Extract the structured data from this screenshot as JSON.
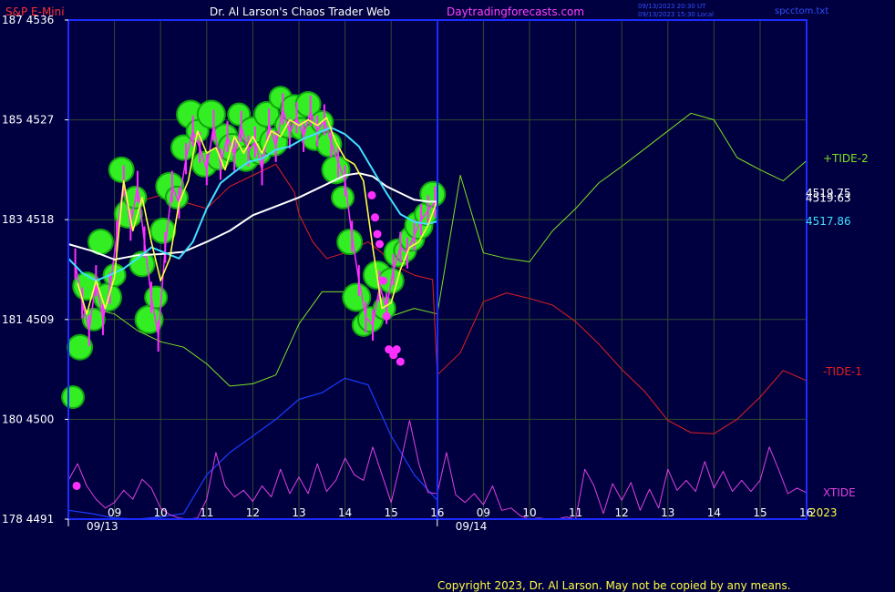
{
  "header": {
    "instrument": "S&P E-Mini",
    "site_title": "Dr. Al Larson's Chaos Trader Web",
    "site_url": "Daytradingforecasts.com",
    "timestamp_1": "09/13/2023 20:30 UT",
    "timestamp_2": "09/13/2023 15:30 Local",
    "file_name": "spcctom.txt"
  },
  "footer": {
    "copyright": "Copyright 2023, Dr. Al Larson. May not be copied by any means.",
    "year": "2023"
  },
  "colors": {
    "background": "#000040",
    "plot_border": "#1c2cff",
    "grid": "#2f4a2f",
    "axis_text": "#ffffff",
    "header_red": "#ff3030",
    "header_white": "#ffffff",
    "header_magenta": "#ff40ff",
    "header_blue": "#3050ff",
    "tide2": "#7ee020",
    "tide1": "#e02020",
    "xtide": "#e040e0",
    "blue_line": "#1a3cff",
    "white_ma": "#ffffff",
    "cyan_ma": "#40e0ff",
    "yellow_ma": "#ffff40",
    "price_bar": "#ff30ff",
    "bubble": "#33ee22",
    "bubble_dark": "#11a511",
    "marker": "#ff30ff"
  },
  "chart_data": {
    "type": "line",
    "y_ticks": [
      {
        "label": "187  4536",
        "value": 4536
      },
      {
        "label": "185  4527",
        "value": 4527
      },
      {
        "label": "183  4518",
        "value": 4518
      },
      {
        "label": "181  4509",
        "value": 4509
      },
      {
        "label": "180  4500",
        "value": 4500
      },
      {
        "label": "178  4491",
        "value": 4491
      }
    ],
    "ylim": [
      4491,
      4536
    ],
    "xlim": [
      0,
      16
    ],
    "x_ticks": [
      {
        "label": "09",
        "x": 1
      },
      {
        "label": "10",
        "x": 2
      },
      {
        "label": "11",
        "x": 3
      },
      {
        "label": "12",
        "x": 4
      },
      {
        "label": "13",
        "x": 5
      },
      {
        "label": "14",
        "x": 6
      },
      {
        "label": "15",
        "x": 7
      },
      {
        "label": "16",
        "x": 8
      },
      {
        "label": "09",
        "x": 9
      },
      {
        "label": "10",
        "x": 10
      },
      {
        "label": "11",
        "x": 11
      },
      {
        "label": "12",
        "x": 12
      },
      {
        "label": "13",
        "x": 13
      },
      {
        "label": "14",
        "x": 14
      },
      {
        "label": "15",
        "x": 15
      },
      {
        "label": "16",
        "x": 16
      }
    ],
    "date_labels": [
      {
        "label": "09/13",
        "x": 0
      },
      {
        "label": "09/14",
        "x": 8
      }
    ],
    "day_divider_x": 8,
    "last_values": [
      {
        "label": "4519.75",
        "value": 4519.75,
        "color": "#ffffff"
      },
      {
        "label": "4519.63",
        "value": 4519.63,
        "color": "#ffffff"
      },
      {
        "label": "4517.86",
        "value": 4517.86,
        "color": "#40e0ff"
      }
    ],
    "legend": [
      {
        "label": "+TIDE-2",
        "value": 4523.5,
        "color": "#7ee020"
      },
      {
        "label": "-TIDE-1",
        "value": 4504.3,
        "color": "#e02020"
      },
      {
        "label": "XTIDE",
        "value": 4493.4,
        "color": "#e040e0"
      }
    ],
    "series": [
      {
        "name": "+TIDE-2",
        "color": "#7ee020",
        "x": [
          0.5,
          1,
          1.5,
          2,
          2.5,
          3,
          3.5,
          4,
          4.5,
          5,
          5.5,
          6,
          6.5,
          7,
          7.5,
          8,
          8.5,
          9,
          9.5,
          10,
          10.5,
          11,
          11.5,
          12,
          12.5,
          13,
          13.5,
          14,
          14.5,
          15,
          15.5,
          16
        ],
        "values": [
          4510,
          4509.5,
          4508,
          4507,
          4506.5,
          4505,
          4503,
          4503.2,
          4504,
          4508.6,
          4511.5,
          4511.5,
          4510,
          4509.3,
          4510,
          4509.5,
          4522,
          4515,
          4514.5,
          4514.2,
          4517,
          4519,
          4521.3,
          4522.8,
          4524.4,
          4526,
          4527.6,
          4527,
          4523.6,
          4522.5,
          4521.5,
          4523.3
        ]
      },
      {
        "name": "-TIDE-1",
        "color": "#e02020",
        "x": [
          1,
          2,
          3,
          3.5,
          4,
          4.5,
          4.9,
          5,
          5.3,
          5.6,
          6,
          6.5,
          6.8,
          7,
          7.5,
          7.9,
          8,
          8.5,
          9,
          9.5,
          10,
          10.5,
          11,
          11.5,
          12,
          12.5,
          13,
          13.5,
          14,
          14.5,
          15,
          15.5,
          16
        ],
        "values": [
          4519,
          4520.2,
          4519,
          4521,
          4522,
          4523,
          4520.5,
          4518.5,
          4516,
          4514.5,
          4515,
          4516,
          4515,
          4514,
          4513,
          4512.6,
          4504,
          4506,
          4510.6,
          4511.4,
          4510.9,
          4510.3,
          4508.8,
          4506.8,
          4504.5,
          4502.5,
          4499.9,
          4498.8,
          4498.7,
          4500,
          4502,
          4504.4,
          4503.5
        ]
      },
      {
        "name": "blue",
        "color": "#1a3cff",
        "x": [
          0,
          0.5,
          1,
          1.5,
          2,
          2.5,
          3,
          3.5,
          4,
          4.5,
          5,
          5.5,
          6,
          6.5,
          7,
          7.5,
          8
        ],
        "values": [
          4491.8,
          4491.5,
          4491.1,
          4491.0,
          4491.2,
          4491.5,
          4495,
          4497,
          4498.5,
          4500,
          4501.8,
          4502.4,
          4503.7,
          4503.1,
          4498.5,
          4495.0,
          4492.7
        ]
      },
      {
        "name": "XTIDE",
        "color": "#e040e0",
        "x": [
          0,
          0.2,
          0.4,
          0.6,
          0.8,
          1.0,
          1.2,
          1.4,
          1.6,
          1.8,
          2.0,
          2.2,
          2.4,
          2.6,
          2.8,
          3.0,
          3.2,
          3.4,
          3.6,
          3.8,
          4.0,
          4.2,
          4.4,
          4.6,
          4.8,
          5.0,
          5.2,
          5.4,
          5.6,
          5.8,
          6.0,
          6.2,
          6.4,
          6.6,
          6.8,
          7.0,
          7.2,
          7.4,
          7.6,
          7.8,
          8.0,
          8.2,
          8.4,
          8.6,
          8.8,
          9.0,
          9.2,
          9.4,
          9.6,
          9.8,
          10.0,
          10.2,
          10.4,
          10.6,
          10.8,
          11.0,
          11.2,
          11.4,
          11.6,
          11.8,
          12.0,
          12.2,
          12.4,
          12.6,
          12.8,
          13.0,
          13.2,
          13.4,
          13.6,
          13.8,
          14.0,
          14.2,
          14.4,
          14.6,
          14.8,
          15.0,
          15.2,
          15.4,
          15.6,
          15.8,
          16
        ],
        "values": [
          4494.5,
          4496,
          4494,
          4492.8,
          4492,
          4492.5,
          4493.6,
          4492.8,
          4494.6,
          4493.8,
          4492,
          4491.4,
          4491.1,
          4491.0,
          4491.1,
          4492.8,
          4497,
          4494,
          4493,
          4493.6,
          4492.6,
          4494,
          4493,
          4495.5,
          4493.3,
          4494.8,
          4493.3,
          4496,
          4493.5,
          4494.5,
          4496.5,
          4495,
          4494.5,
          4497.5,
          4495,
          4492.5,
          4496,
          4499.9,
          4496,
          4493.4,
          4493.3,
          4497,
          4493.2,
          4492.5,
          4493.3,
          4492.3,
          4494,
          4491.8,
          4492,
          4491.3,
          4491.0,
          4491.1,
          4491.0,
          4491.0,
          4491.2,
          4491.0,
          4495.5,
          4494,
          4491.5,
          4494.2,
          4492.7,
          4494.3,
          4491.8,
          4493.7,
          4492,
          4495.5,
          4493.6,
          4494.5,
          4493.5,
          4496.2,
          4493.8,
          4495.3,
          4493.5,
          4494.5,
          4493.5,
          4494.5,
          4497.5,
          4495.5,
          4493.3,
          4493.8,
          4493.4
        ]
      },
      {
        "name": "white",
        "color": "#ffffff",
        "x": [
          0,
          0.5,
          1,
          1.5,
          2,
          2.5,
          3,
          3.5,
          4,
          4.5,
          5,
          5.5,
          6,
          6.3,
          6.6,
          6.9,
          7.2,
          7.5,
          7.8,
          8
        ],
        "values": [
          4515.8,
          4515.2,
          4514.4,
          4514.8,
          4514.9,
          4515.1,
          4516,
          4517,
          4518.4,
          4519.2,
          4520,
          4521,
          4522,
          4522.2,
          4521.9,
          4521.0,
          4520.4,
          4519.8,
          4519.63,
          4519.63
        ]
      },
      {
        "name": "cyan",
        "color": "#40e0ff",
        "x": [
          0,
          0.3,
          0.6,
          0.9,
          1.2,
          1.5,
          1.8,
          2.1,
          2.4,
          2.7,
          3.0,
          3.3,
          3.6,
          3.9,
          4.2,
          4.5,
          4.8,
          5.1,
          5.4,
          5.7,
          6.0,
          6.3,
          6.6,
          6.9,
          7.2,
          7.5,
          7.8,
          8
        ],
        "values": [
          4514.5,
          4513.2,
          4512.5,
          4513,
          4513.6,
          4514.5,
          4515.5,
          4515,
          4514.5,
          4516,
          4519,
          4521.3,
          4522.3,
          4523.2,
          4523.5,
          4524.3,
          4524.6,
          4525.3,
          4525.8,
          4526.3,
          4525.7,
          4524.6,
          4522.5,
          4520.4,
          4518.5,
          4517.8,
          4517.6,
          4517.86
        ]
      },
      {
        "name": "yellow",
        "color": "#ffff40",
        "x": [
          0.2,
          0.4,
          0.6,
          0.8,
          1.0,
          1.2,
          1.4,
          1.6,
          1.8,
          2.0,
          2.2,
          2.4,
          2.6,
          2.8,
          3.0,
          3.2,
          3.4,
          3.6,
          3.8,
          4.0,
          4.2,
          4.4,
          4.6,
          4.8,
          5.0,
          5.2,
          5.4,
          5.6,
          5.8,
          6.0,
          6.2,
          6.4,
          6.6,
          6.8,
          7.0,
          7.2,
          7.4,
          7.6,
          7.8,
          8.0
        ],
        "values": [
          4512.3,
          4509.5,
          4512.5,
          4510,
          4512.8,
          4521.5,
          4517,
          4520,
          4516,
          4512.5,
          4514.5,
          4519.5,
          4521.5,
          4526,
          4524,
          4524.5,
          4522.5,
          4525.5,
          4524,
          4525.5,
          4524,
          4526,
          4525.5,
          4527,
          4526.5,
          4527,
          4526.5,
          4527.2,
          4525,
          4523.5,
          4523,
          4521.5,
          4515.5,
          4510,
          4510.5,
          4513.5,
          4515.5,
          4516,
          4517.5,
          4519.75
        ]
      },
      {
        "name": "price",
        "color": "#ff30ff",
        "x": [
          0.15,
          0.3,
          0.45,
          0.6,
          0.75,
          0.9,
          1.05,
          1.2,
          1.35,
          1.5,
          1.65,
          1.8,
          1.95,
          2.1,
          2.25,
          2.4,
          2.55,
          2.7,
          2.85,
          3.0,
          3.15,
          3.3,
          3.45,
          3.6,
          3.75,
          3.9,
          4.05,
          4.2,
          4.35,
          4.5,
          4.65,
          4.8,
          4.95,
          5.1,
          5.25,
          5.4,
          5.55,
          5.7,
          5.85,
          6.0,
          6.15,
          6.3,
          6.45,
          6.6,
          6.75,
          6.9,
          7.05,
          7.2,
          7.35,
          7.5,
          7.65,
          7.8,
          7.95
        ],
        "values": [
          4514,
          4510.5,
          4508,
          4512.5,
          4509,
          4511.8,
          4516.5,
          4521.5,
          4517.5,
          4521,
          4516,
          4511,
          4507.5,
          4515.5,
          4521,
          4519.5,
          4523.5,
          4526,
          4524.5,
          4522.5,
          4526.5,
          4523,
          4525.5,
          4523.8,
          4526.4,
          4524.2,
          4525,
          4522.5,
          4526.6,
          4524.6,
          4528,
          4525.8,
          4527.2,
          4525.5,
          4527.8,
          4526,
          4527,
          4525,
          4523.2,
          4521.5,
          4516.5,
          4512.5,
          4509.2,
          4508.5,
          4512,
          4510,
          4513.5,
          4515.5,
          4515,
          4516.6,
          4518,
          4518.8,
          4519.6
        ]
      },
      {
        "name": "bubbles",
        "color": "#33ee22",
        "x": [
          0.1,
          0.25,
          0.4,
          0.55,
          0.7,
          0.85,
          1.0,
          1.15,
          1.3,
          1.45,
          1.6,
          1.75,
          1.9,
          2.05,
          2.2,
          2.35,
          2.5,
          2.65,
          2.8,
          2.95,
          3.1,
          3.25,
          3.4,
          3.55,
          3.7,
          3.85,
          4.0,
          4.15,
          4.3,
          4.45,
          4.6,
          4.75,
          4.9,
          5.05,
          5.2,
          5.35,
          5.5,
          5.65,
          5.8,
          5.95,
          6.1,
          6.25,
          6.4,
          6.55,
          6.7,
          6.85,
          7.0,
          7.15,
          7.3,
          7.45,
          7.6,
          7.75,
          7.9
        ],
        "values": [
          4502,
          4506.5,
          4512,
          4509,
          4516,
          4511,
          4513,
          4522.5,
          4518.5,
          4520,
          4514,
          4509,
          4511,
          4517,
          4521,
          4520,
          4524.5,
          4527.5,
          4526,
          4523,
          4527.5,
          4523.5,
          4525.5,
          4524.5,
          4527.5,
          4523.5,
          4526,
          4524,
          4527.5,
          4525,
          4529,
          4526.5,
          4528,
          4526.2,
          4528.4,
          4525.5,
          4526.8,
          4524.8,
          4522.5,
          4520,
          4516,
          4511,
          4508.5,
          4509,
          4513,
          4510,
          4512.5,
          4515,
          4515.2,
          4516.3,
          4517.5,
          4518.5,
          4520.3
        ]
      },
      {
        "name": "markers",
        "color": "#ff30ff",
        "x": [
          0.18,
          6.58,
          6.65,
          6.7,
          6.75,
          6.83,
          6.9,
          6.95,
          7.05,
          7.12,
          7.2
        ],
        "values": [
          4494,
          4520.2,
          4518.2,
          4516.7,
          4515.8,
          4512.5,
          4509.3,
          4506.3,
          4505.8,
          4506.3,
          4505.2
        ]
      }
    ]
  }
}
